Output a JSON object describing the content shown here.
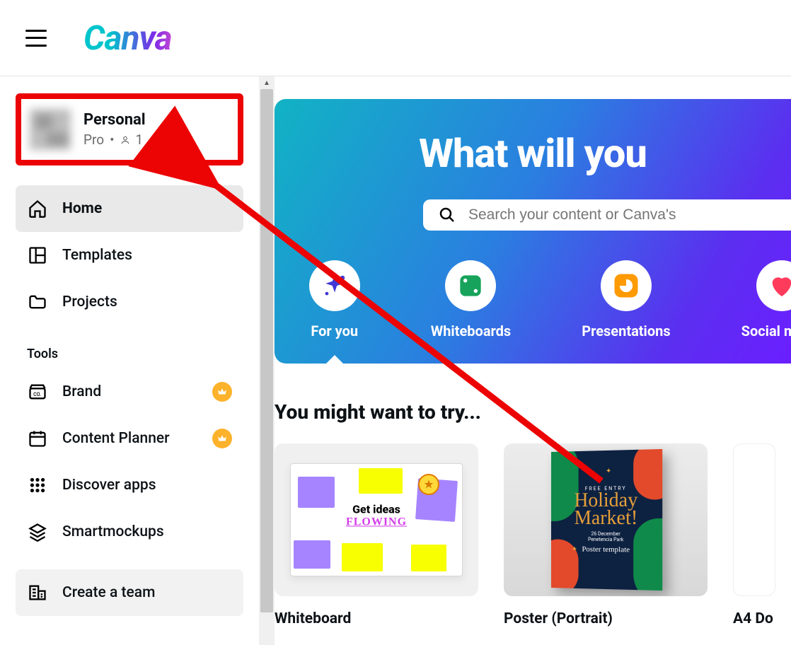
{
  "header": {
    "logo_text": "Canva"
  },
  "profile": {
    "name": "Personal",
    "plan": "Pro",
    "separator": "•",
    "member_count": "1"
  },
  "sidebar": {
    "items": [
      {
        "id": "home",
        "label": "Home",
        "active": true
      },
      {
        "id": "templates",
        "label": "Templates"
      },
      {
        "id": "projects",
        "label": "Projects"
      }
    ],
    "tools_heading": "Tools",
    "tools": [
      {
        "id": "brand",
        "label": "Brand",
        "pro": true
      },
      {
        "id": "content-planner",
        "label": "Content Planner",
        "pro": true
      },
      {
        "id": "discover-apps",
        "label": "Discover apps"
      },
      {
        "id": "smartmockups",
        "label": "Smartmockups"
      }
    ],
    "create_team_label": "Create a team"
  },
  "hero": {
    "title": "What will you",
    "search_placeholder": "Search your content or Canva's",
    "categories": [
      {
        "id": "for-you",
        "label": "For you",
        "icon": "sparkle",
        "color": "#4038d4"
      },
      {
        "id": "whiteboards",
        "label": "Whiteboards",
        "icon": "board",
        "color": "#17a35b"
      },
      {
        "id": "presentations",
        "label": "Presentations",
        "icon": "presentation",
        "color": "#ff9a00"
      },
      {
        "id": "social-media",
        "label": "Social media",
        "icon": "heart",
        "color": "#ff3b5c"
      }
    ]
  },
  "suggestions": {
    "heading": "You might want to try...",
    "cards": [
      {
        "id": "whiteboard",
        "label": "Whiteboard",
        "art_line1": "Get ideas",
        "art_line2": "FLOWING"
      },
      {
        "id": "poster",
        "label": "Poster (Portrait)",
        "art_free": "FREE ENTRY",
        "art_title": "Holiday Market!",
        "art_date": "26 December",
        "art_place": "Penetencia Park",
        "art_template": "Poster template"
      },
      {
        "id": "a4-doc",
        "label": "A4 Do"
      }
    ]
  }
}
